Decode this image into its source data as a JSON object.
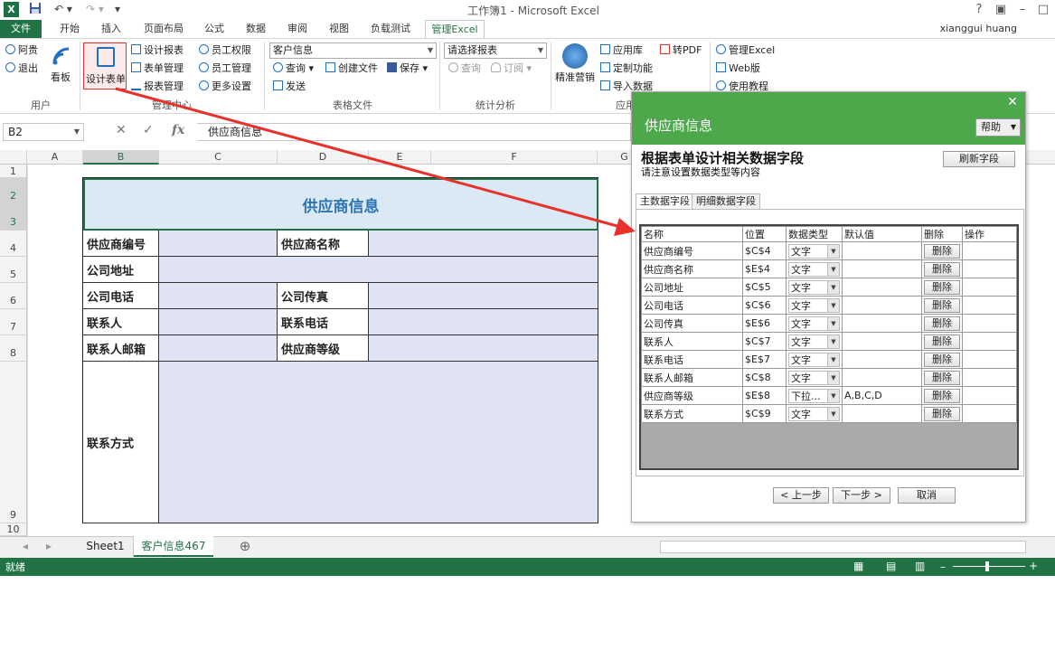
{
  "window": {
    "title": "工作簿1 - Microsoft Excel",
    "user": "xianggui huang"
  },
  "tabs": [
    "文件",
    "开始",
    "插入",
    "页面布局",
    "公式",
    "数据",
    "审阅",
    "视图",
    "负载测试",
    "管理Excel"
  ],
  "ribbon": {
    "user_group": {
      "items": [
        "阿贵",
        "退出"
      ],
      "big": "看板",
      "label": "用户"
    },
    "manage_group": {
      "design": "设计表单",
      "items": [
        "设计报表",
        "表单管理",
        "报表管理",
        "员工权限",
        "员工管理",
        "更多设置"
      ],
      "label": "管理中心"
    },
    "file_group": {
      "combo": "客户信息",
      "items": [
        "查询",
        "创建文件",
        "保存",
        "发送"
      ],
      "label": "表格文件"
    },
    "stats_group": {
      "combo": "请选择报表",
      "items": [
        "查询",
        "订阅"
      ],
      "label": "统计分析"
    },
    "app_group": {
      "big": "精准营销",
      "items": [
        "应用库",
        "转PDF",
        "定制功能",
        "导入数据"
      ],
      "label": "应用"
    },
    "extra_group": {
      "items": [
        "管理Excel",
        "Web版",
        "使用教程"
      ]
    }
  },
  "formula_bar": {
    "name_box": "B2",
    "fx": "fx",
    "formula": "供应商信息"
  },
  "columns": [
    "A",
    "B",
    "C",
    "D",
    "E",
    "F",
    "G"
  ],
  "rows": [
    "1",
    "2",
    "3",
    "4",
    "5",
    "6",
    "7",
    "8",
    "9",
    "10"
  ],
  "sheet": {
    "title": "供应商信息",
    "labels": {
      "supplier_no": "供应商编号",
      "supplier_name": "供应商名称",
      "address": "公司地址",
      "phone": "公司电话",
      "fax": "公司传真",
      "contact": "联系人",
      "contact_phone": "联系电话",
      "contact_email": "联系人邮箱",
      "level": "供应商等级",
      "contact_method": "联系方式"
    }
  },
  "sheet_tabs": [
    "Sheet1",
    "客户信息467"
  ],
  "status": {
    "ready": "就绪"
  },
  "dialog": {
    "title": "供应商信息",
    "help": "帮助",
    "heading": "根据表单设计相关数据字段",
    "subheading": "请注意设置数据类型等内容",
    "refresh": "刷新字段",
    "tabs": [
      "主数据字段",
      "明细数据字段"
    ],
    "table_headers": [
      "名称",
      "位置",
      "数据类型",
      "默认值",
      "删除",
      "操作"
    ],
    "fields": [
      {
        "name": "供应商编号",
        "pos": "$C$4",
        "type": "文字",
        "default": "",
        "del": "删除"
      },
      {
        "name": "供应商名称",
        "pos": "$E$4",
        "type": "文字",
        "default": "",
        "del": "删除"
      },
      {
        "name": "公司地址",
        "pos": "$C$5",
        "type": "文字",
        "default": "",
        "del": "删除"
      },
      {
        "name": "公司电话",
        "pos": "$C$6",
        "type": "文字",
        "default": "",
        "del": "删除"
      },
      {
        "name": "公司传真",
        "pos": "$E$6",
        "type": "文字",
        "default": "",
        "del": "删除"
      },
      {
        "name": "联系人",
        "pos": "$C$7",
        "type": "文字",
        "default": "",
        "del": "删除"
      },
      {
        "name": "联系电话",
        "pos": "$E$7",
        "type": "文字",
        "default": "",
        "del": "删除"
      },
      {
        "name": "联系人邮箱",
        "pos": "$C$8",
        "type": "文字",
        "default": "",
        "del": "删除"
      },
      {
        "name": "供应商等级",
        "pos": "$E$8",
        "type": "下拉...",
        "default": "A,B,C,D",
        "del": "删除"
      },
      {
        "name": "联系方式",
        "pos": "$C$9",
        "type": "文字",
        "default": "",
        "del": "删除"
      }
    ],
    "prev": "< 上一步",
    "next": "下一步 >",
    "cancel": "取消"
  },
  "colors": {
    "excel_green": "#217346",
    "dialog_green": "#4ca84a",
    "arrow_red": "#e8312b",
    "cell_fill": "#dfe3f3"
  }
}
